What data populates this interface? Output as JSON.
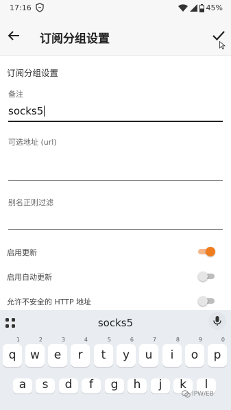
{
  "status_bar": {
    "time": "17:16",
    "battery": "45%"
  },
  "app_bar": {
    "title": "订阅分组设置"
  },
  "section_title": "订阅分组设置",
  "fields": [
    {
      "label": "备注",
      "value": "socks5"
    },
    {
      "label": "可选地址 (url)",
      "value": ""
    },
    {
      "label": "别名正则过滤",
      "value": ""
    }
  ],
  "switches": [
    {
      "label": "启用更新",
      "on": true
    },
    {
      "label": "启用自动更新",
      "on": false
    },
    {
      "label": "允许不安全的 HTTP 地址",
      "on": false
    }
  ],
  "keyboard": {
    "suggestion": "socks5",
    "row1": [
      {
        "key": "q",
        "hint": "1"
      },
      {
        "key": "w",
        "hint": "2"
      },
      {
        "key": "e",
        "hint": "3"
      },
      {
        "key": "r",
        "hint": "4"
      },
      {
        "key": "t",
        "hint": "5"
      },
      {
        "key": "y",
        "hint": "6"
      },
      {
        "key": "u",
        "hint": "7"
      },
      {
        "key": "i",
        "hint": "8"
      },
      {
        "key": "o",
        "hint": "9"
      },
      {
        "key": "p",
        "hint": "0"
      }
    ],
    "row2": [
      "a",
      "s",
      "d",
      "f",
      "g",
      "h",
      "j",
      "k",
      "l"
    ]
  },
  "watermark": "IPW/EB",
  "colors": {
    "accent": "#ef7d1f",
    "accent_track": "#f5b78a",
    "app_bar_bg": "#f7f7f7",
    "keyboard_bg": "#e9edf1"
  }
}
